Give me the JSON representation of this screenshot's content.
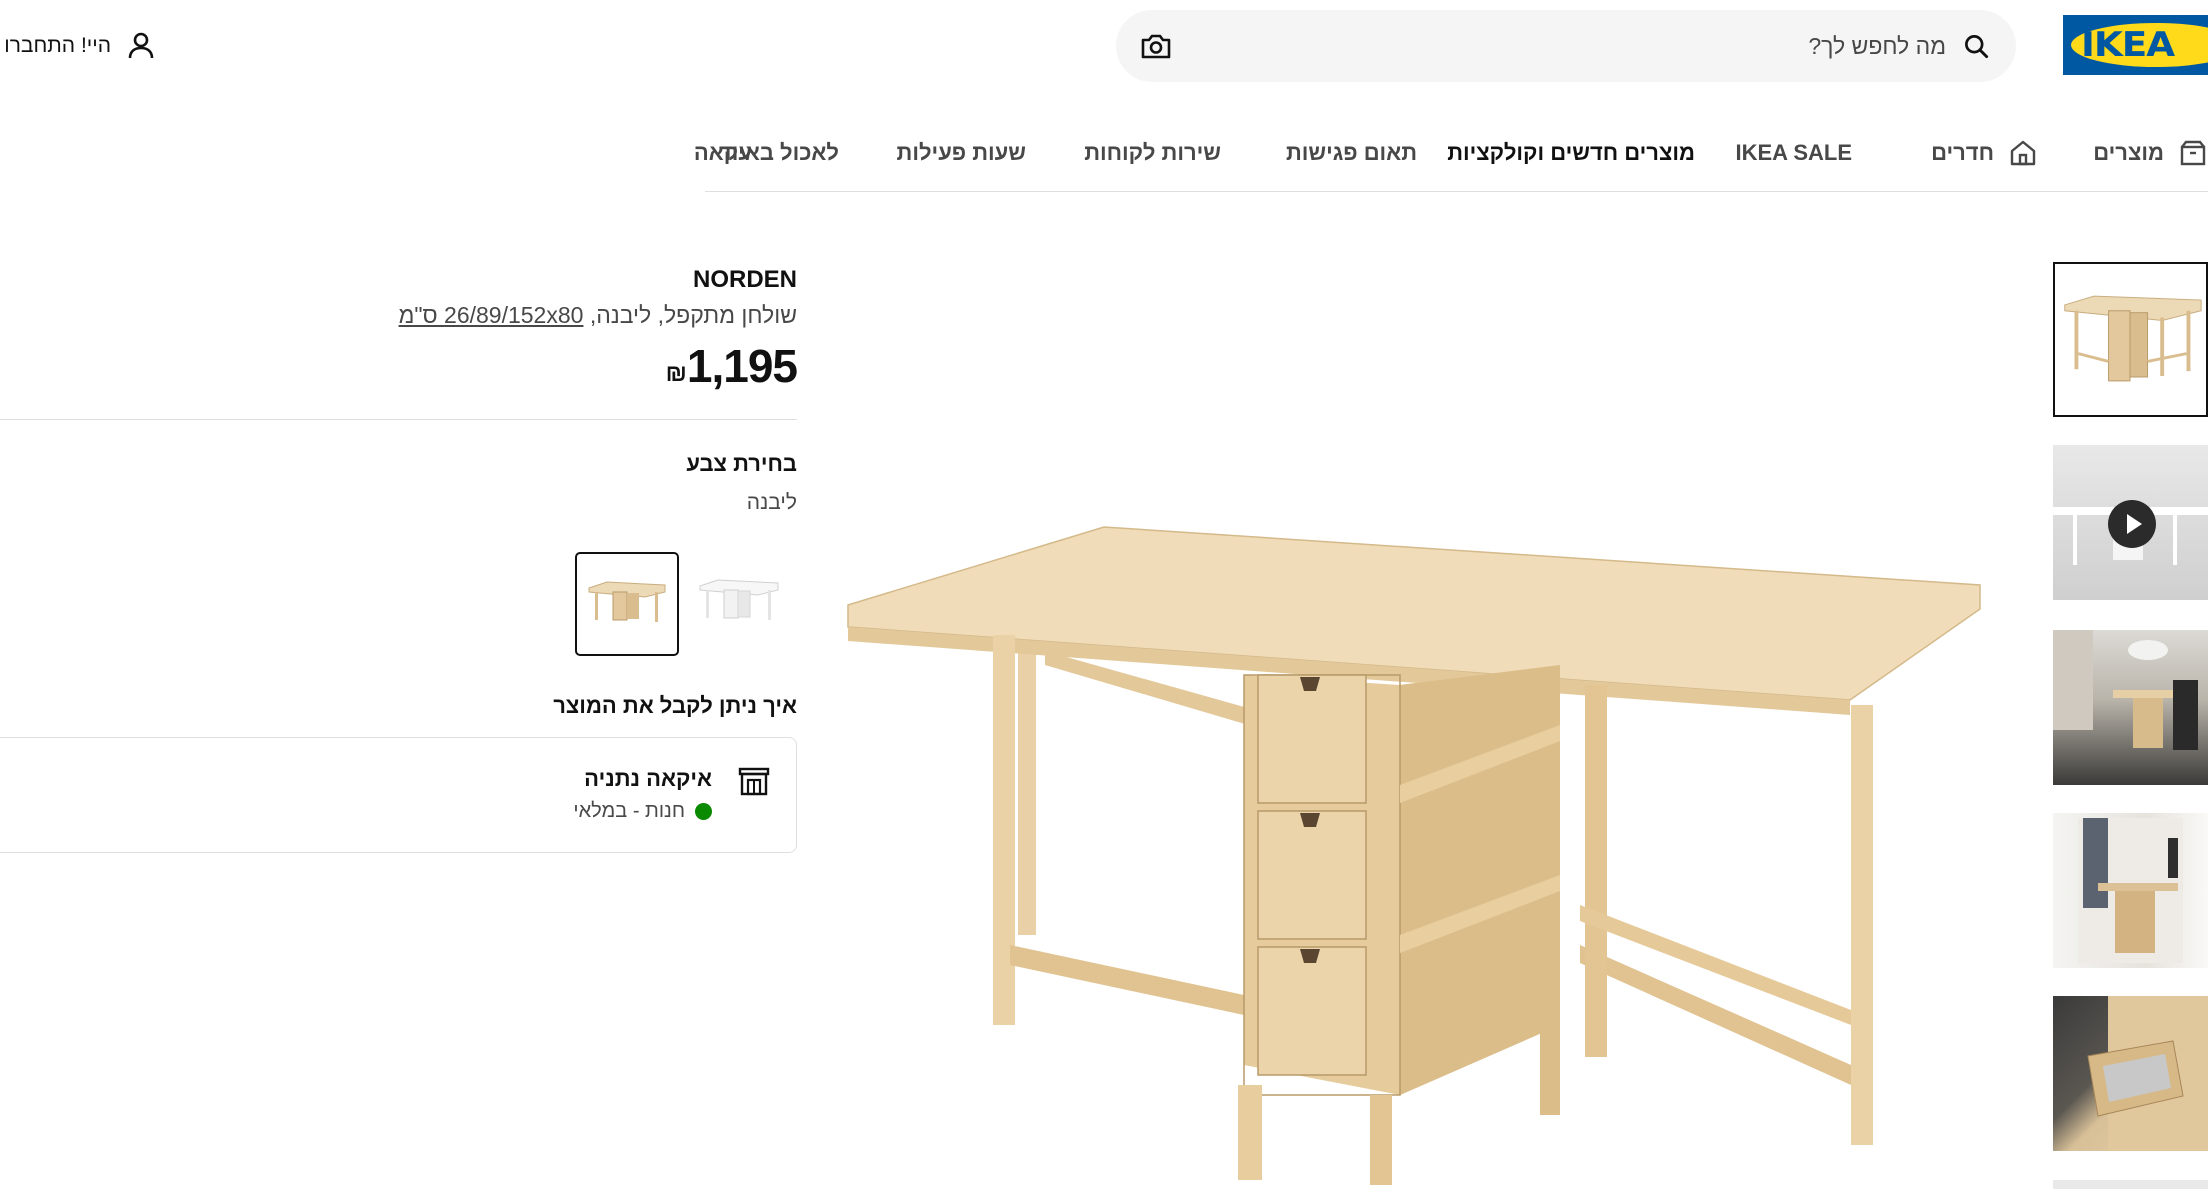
{
  "header": {
    "logo_text": "IKEA",
    "search_placeholder": "מה לחפש לך?",
    "login_text": "היי! התחברו"
  },
  "nav": {
    "items": [
      {
        "label": "מוצרים",
        "icon": "box-icon"
      },
      {
        "label": "חדרים",
        "icon": "home-icon"
      },
      {
        "label": "IKEA SALE"
      },
      {
        "label": "מוצרים חדשים וקולקציות"
      },
      {
        "label": "תאום פגישות"
      },
      {
        "label": "שירות לקוחות"
      },
      {
        "label": "שעות פעילות"
      },
      {
        "label": "לאכול באיקאה"
      },
      {
        "label": "עוד"
      }
    ]
  },
  "product": {
    "name": "NORDEN",
    "description": "שולחן מתקפל, ליבנה,",
    "dimensions": "26/89/152x80 ס\"מ",
    "price": "1,195",
    "currency": "₪"
  },
  "color": {
    "title": "בחירת צבע",
    "selected": "ליבנה",
    "options": [
      "ליבנה",
      "לבן"
    ]
  },
  "delivery": {
    "title": "איך ניתן לקבל את המוצר",
    "store_name": "איקאה נתניה",
    "store_status": "חנות - במלאי",
    "status_color": "#0a8a00"
  },
  "colors": {
    "brand_blue": "#0058a3",
    "brand_yellow": "#ffda1a",
    "wood": "#e9d3ad"
  }
}
